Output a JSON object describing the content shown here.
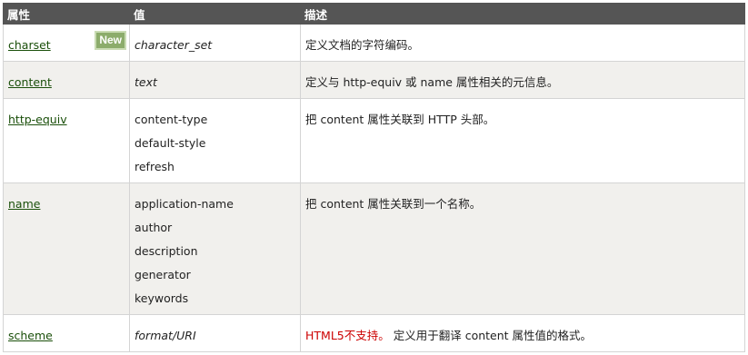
{
  "header": {
    "col_attr": "属性",
    "col_value": "值",
    "col_desc": "描述"
  },
  "rows": [
    {
      "attr": "charset",
      "badge": "New",
      "values": [
        "character_set"
      ],
      "values_italic": true,
      "desc_prefix": "",
      "desc": "定义文档的字符编码。"
    },
    {
      "attr": "content",
      "values": [
        "text"
      ],
      "values_italic": true,
      "desc_prefix": "",
      "desc": "定义与 http-equiv 或 name 属性相关的元信息。"
    },
    {
      "attr": "http-equiv",
      "values": [
        "content-type",
        "default-style",
        "refresh"
      ],
      "values_italic": false,
      "desc_prefix": "",
      "desc": "把 content 属性关联到 HTTP 头部。"
    },
    {
      "attr": "name",
      "values": [
        "application-name",
        "author",
        "description",
        "generator",
        "keywords"
      ],
      "values_italic": false,
      "desc_prefix": "",
      "desc": "把 content 属性关联到一个名称。"
    },
    {
      "attr": "scheme",
      "values": [
        "format/URI"
      ],
      "values_italic": true,
      "desc_prefix": "HTML5不支持。",
      "desc": " 定义用于翻译 content 属性值的格式。"
    }
  ],
  "colors": {
    "header_bg": "#555555",
    "alt_row_bg": "#f1f0ed",
    "link": "#1a4f0a",
    "badge_bg": "#8cac6b",
    "not_supported": "#cc0000"
  }
}
